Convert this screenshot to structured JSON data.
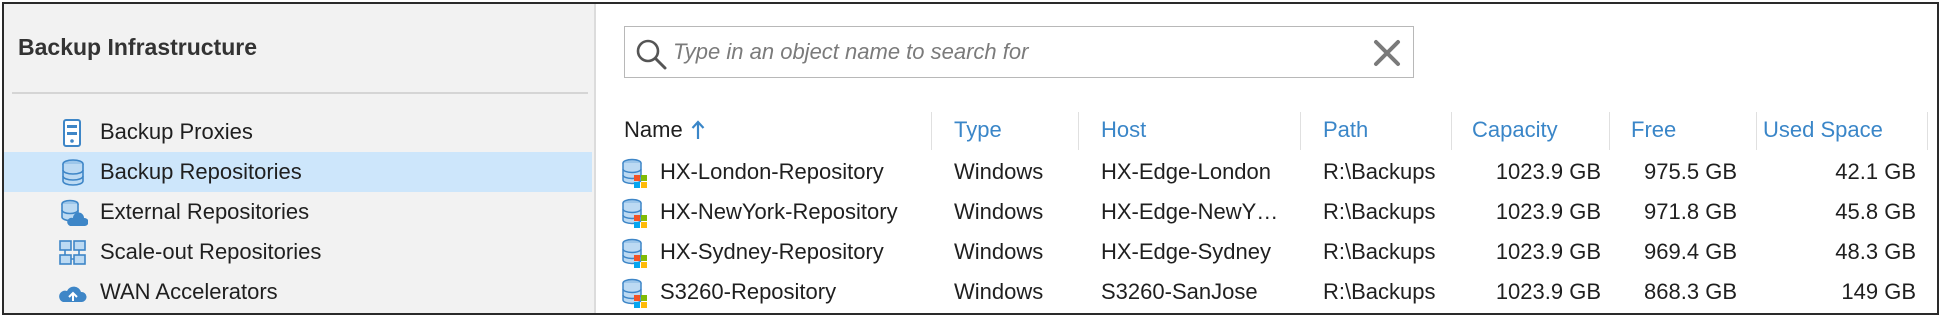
{
  "nav": {
    "header": "Backup Infrastructure",
    "items": [
      {
        "label": "Backup Proxies",
        "icon": "backup-proxy-icon",
        "selected": false
      },
      {
        "label": "Backup Repositories",
        "icon": "backup-repository-icon",
        "selected": true
      },
      {
        "label": "External Repositories",
        "icon": "external-repository-icon",
        "selected": false
      },
      {
        "label": "Scale-out Repositories",
        "icon": "scale-out-repository-icon",
        "selected": false
      },
      {
        "label": "WAN Accelerators",
        "icon": "wan-accelerator-icon",
        "selected": false
      }
    ]
  },
  "search": {
    "placeholder": "Type in an object name to search for",
    "value": ""
  },
  "table": {
    "sort": {
      "column": "Name",
      "direction": "ascending"
    },
    "columns": [
      "Name",
      "Type",
      "Host",
      "Path",
      "Capacity",
      "Free",
      "Used Space"
    ],
    "rows": [
      {
        "name": "HX-London-Repository",
        "type": "Windows",
        "host": "HX-Edge-London",
        "path": "R:\\Backups",
        "capacity": "1023.9 GB",
        "free": "975.5 GB",
        "used": "42.1 GB"
      },
      {
        "name": "HX-NewYork-Repository",
        "type": "Windows",
        "host": "HX-Edge-NewY…",
        "path": "R:\\Backups",
        "capacity": "1023.9 GB",
        "free": "971.8 GB",
        "used": "45.8 GB"
      },
      {
        "name": "HX-Sydney-Repository",
        "type": "Windows",
        "host": "HX-Edge-Sydney",
        "path": "R:\\Backups",
        "capacity": "1023.9 GB",
        "free": "969.4 GB",
        "used": "48.3 GB"
      },
      {
        "name": "S3260-Repository",
        "type": "Windows",
        "host": "S3260-SanJose",
        "path": "R:\\Backups",
        "capacity": "1023.9 GB",
        "free": "868.3 GB",
        "used": "149 GB"
      }
    ]
  },
  "colors": {
    "accent_header": "#3a86c8",
    "selection": "#cde6fb",
    "nav_background": "#f2f2f2",
    "icon_blue": "#3e86c7"
  }
}
